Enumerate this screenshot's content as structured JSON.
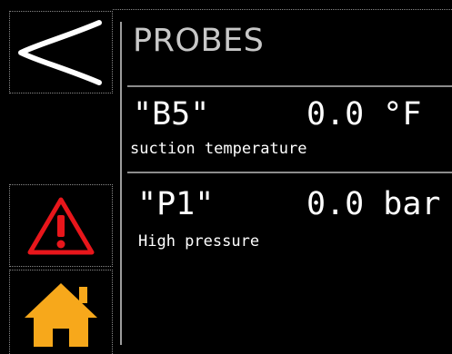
{
  "header": {
    "title": "PROBES"
  },
  "sidebar": {
    "back_icon": "chevron-left-icon",
    "alarm_icon": "warning-triangle-icon",
    "home_icon": "home-icon"
  },
  "probes": [
    {
      "id": "\"B5\"",
      "value": "0.0 °F",
      "description": "suction temperature"
    },
    {
      "id": "\"P1\"",
      "value": "0.0 bar",
      "description": "High pressure"
    }
  ],
  "colors": {
    "background": "#000000",
    "alarm_red": "#e8161b",
    "home_orange": "#f7a81b",
    "title_gray": "#c8c8c8"
  }
}
